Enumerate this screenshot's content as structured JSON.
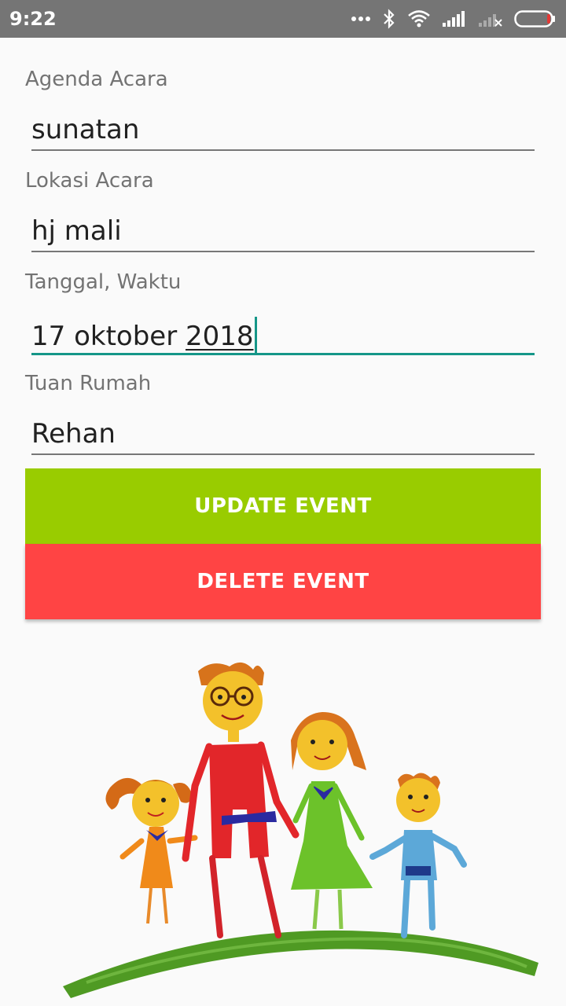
{
  "status_bar": {
    "time": "9:22",
    "icons": [
      "more-dots-icon",
      "bluetooth-icon",
      "wifi-icon",
      "signal-icon",
      "no-signal-icon",
      "battery-icon"
    ]
  },
  "form": {
    "fields": [
      {
        "label": "Agenda Acara",
        "value": "sunatan"
      },
      {
        "label": "Lokasi Acara",
        "value": "hj mali"
      },
      {
        "label": "Tanggal, Waktu",
        "value_prefix": "17 oktober ",
        "value_underlined": "2018",
        "focused": true
      },
      {
        "label": "Tuan Rumah",
        "value": "Rehan"
      }
    ]
  },
  "buttons": {
    "update_label": "UPDATE EVENT",
    "delete_label": "DELETE EVENT"
  },
  "colors": {
    "status_bar": "#757575",
    "update_button": "#99cc00",
    "delete_button": "#ff4444",
    "focus_accent": "#159688"
  },
  "image": {
    "subject": "family-drawing-illustration"
  }
}
